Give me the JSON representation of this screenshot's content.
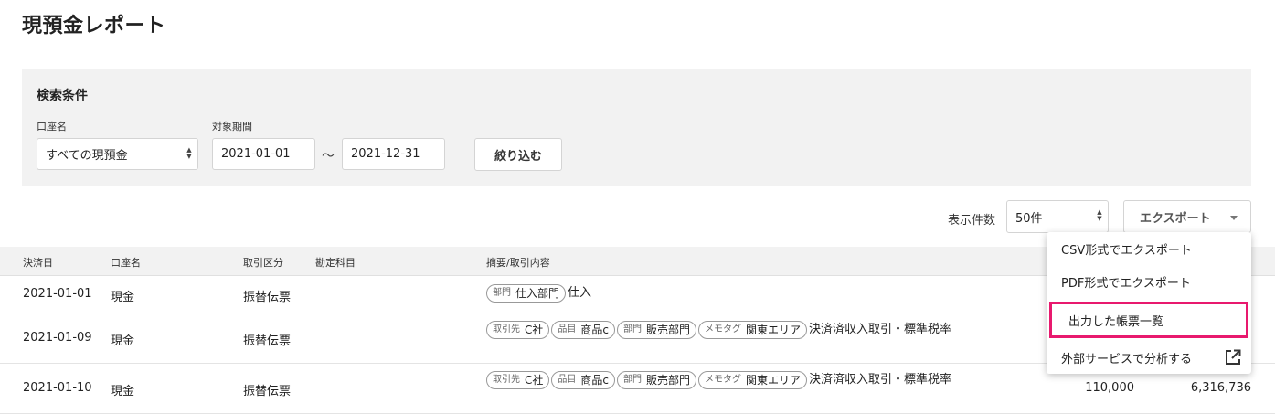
{
  "page": {
    "title": "現預金レポート"
  },
  "search": {
    "title": "検索条件",
    "account_label": "口座名",
    "account_value": "すべての現預金",
    "period_label": "対象期間",
    "start_date": "2021-01-01",
    "range_separator": "〜",
    "end_date": "2021-12-31",
    "filter_button": "絞り込む"
  },
  "toolbar": {
    "count_label": "表示件数",
    "count_value": "50件",
    "export_button": "エクスポート"
  },
  "export_menu": {
    "items": [
      {
        "label": "CSV形式でエクスポート"
      },
      {
        "label": "PDF形式でエクスポート"
      },
      {
        "label": "出力した帳票一覧"
      },
      {
        "label": "外部サービスで分析する"
      }
    ]
  },
  "table": {
    "headers": {
      "date": "決済日",
      "account": "口座名",
      "type": "取引区分",
      "subject": "勘定科目",
      "content": "摘要/取引内容"
    },
    "rows": [
      {
        "date": "2021-01-01",
        "account": "現金",
        "type": "振替伝票",
        "tags": [
          {
            "key": "部門",
            "value": "仕入部門"
          }
        ],
        "text": "仕入",
        "amount": "",
        "balance": ""
      },
      {
        "date": "2021-01-09",
        "account": "現金",
        "type": "振替伝票",
        "tags": [
          {
            "key": "取引先",
            "value": "C社"
          },
          {
            "key": "品目",
            "value": "商品c"
          },
          {
            "key": "部門",
            "value": "販売部門"
          },
          {
            "key": "メモタグ",
            "value": "関東エリア"
          }
        ],
        "text": "決済済収入取引・標準税率",
        "amount": "",
        "balance": ""
      },
      {
        "date": "2021-01-10",
        "account": "現金",
        "type": "振替伝票",
        "tags": [
          {
            "key": "取引先",
            "value": "C社"
          },
          {
            "key": "品目",
            "value": "商品c"
          },
          {
            "key": "部門",
            "value": "販売部門"
          },
          {
            "key": "メモタグ",
            "value": "関東エリア"
          }
        ],
        "text": "決済済収入取引・標準税率",
        "amount": "110,000",
        "balance": "6,316,736"
      }
    ]
  },
  "colors": {
    "highlight": "#e8196e",
    "panel_bg": "#f2f2f2"
  }
}
